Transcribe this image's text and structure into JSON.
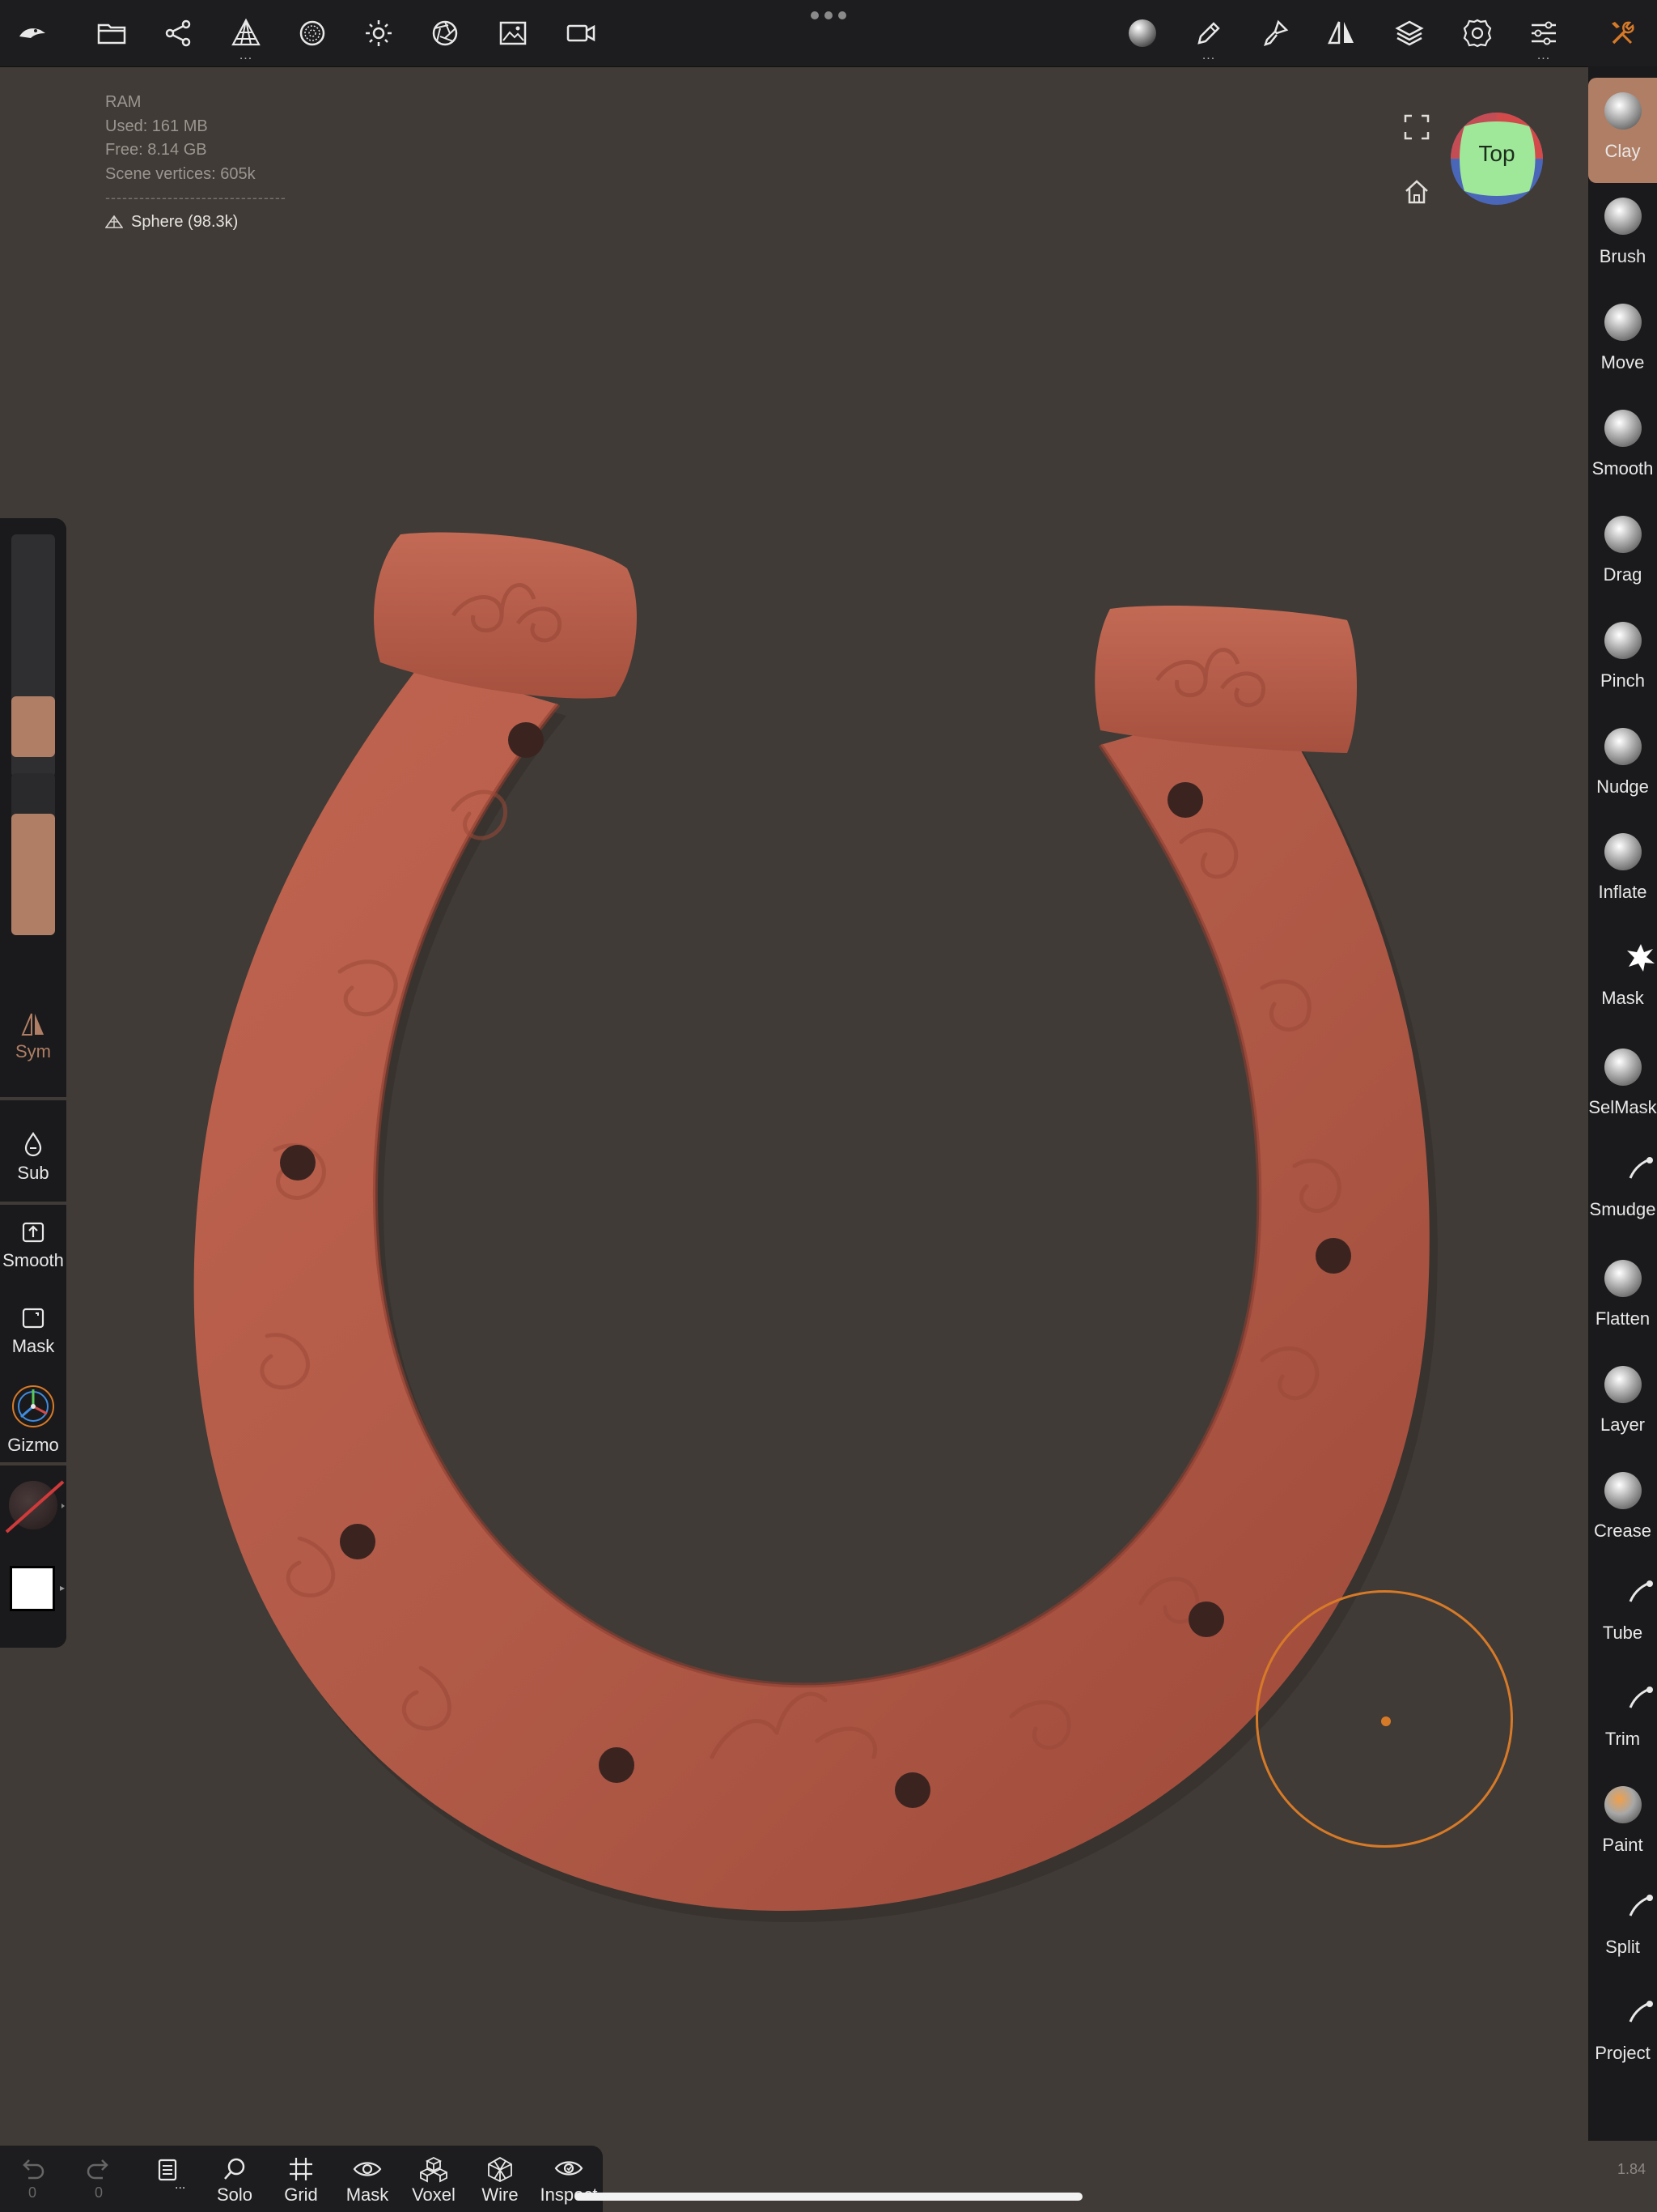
{
  "stats": {
    "ram_label": "RAM",
    "used": "Used:  161 MB",
    "free": "Free:  8.14 GB",
    "vertices": "Scene vertices:  605k",
    "separator": "--------------------------------",
    "object": "Sphere (98.3k)"
  },
  "top_toolbar": {
    "left_icons": [
      "nomad-logo-icon",
      "folder-icon",
      "scene-graph-icon",
      "topology-icon",
      "material-sphere-icon",
      "light-icon",
      "postprocess-icon",
      "background-image-icon",
      "camera-icon"
    ],
    "right_icons": [
      "material-preview-icon",
      "stroke-icon",
      "paint-tool-icon",
      "symmetry-icon",
      "layers-icon",
      "settings-icon",
      "sliders-icon",
      "tools-icon"
    ],
    "more_marker": "..."
  },
  "view": {
    "navcube_label": "Top"
  },
  "left_panel": {
    "radius_level": 0.35,
    "intensity_level": 0.75,
    "sym_label": "Sym",
    "sub_label": "Sub",
    "smooth_label": "Smooth",
    "mask_label": "Mask",
    "gizmo_label": "Gizmo",
    "color_swatch": "#ffffff"
  },
  "tools": [
    {
      "label": "Clay",
      "icon": "clay-ball-icon"
    },
    {
      "label": "Brush",
      "icon": "brush-ball-icon"
    },
    {
      "label": "Move",
      "icon": "move-ball-icon"
    },
    {
      "label": "Smooth",
      "icon": "smooth-ball-icon"
    },
    {
      "label": "Drag",
      "icon": "drag-ball-icon"
    },
    {
      "label": "Pinch",
      "icon": "pinch-ball-icon"
    },
    {
      "label": "Nudge",
      "icon": "nudge-ball-icon"
    },
    {
      "label": "Inflate",
      "icon": "inflate-ball-icon"
    },
    {
      "label": "Mask",
      "icon": "mask-splat-icon"
    },
    {
      "label": "SelMask",
      "icon": "selmask-ball-icon"
    },
    {
      "label": "Smudge",
      "icon": "smudge-icon"
    },
    {
      "label": "Flatten",
      "icon": "flatten-ball-icon"
    },
    {
      "label": "Layer",
      "icon": "layer-ball-icon"
    },
    {
      "label": "Crease",
      "icon": "crease-ball-icon"
    },
    {
      "label": "Tube",
      "icon": "tube-icon"
    },
    {
      "label": "Trim",
      "icon": "trim-icon"
    },
    {
      "label": "Paint",
      "icon": "paint-ball-icon"
    },
    {
      "label": "Split",
      "icon": "split-icon"
    },
    {
      "label": "Project",
      "icon": "project-icon"
    }
  ],
  "bottom_bar": {
    "undo_count": "0",
    "redo_count": "0",
    "more": "...",
    "solo": "Solo",
    "grid": "Grid",
    "mask": "Mask",
    "voxel": "Voxel",
    "wire": "Wire",
    "inspect": "Inspect"
  },
  "version": "1.84",
  "colors": {
    "accent": "#b07e64",
    "cursor": "#d77a28",
    "background": "#403b36",
    "model": "#b05848"
  }
}
